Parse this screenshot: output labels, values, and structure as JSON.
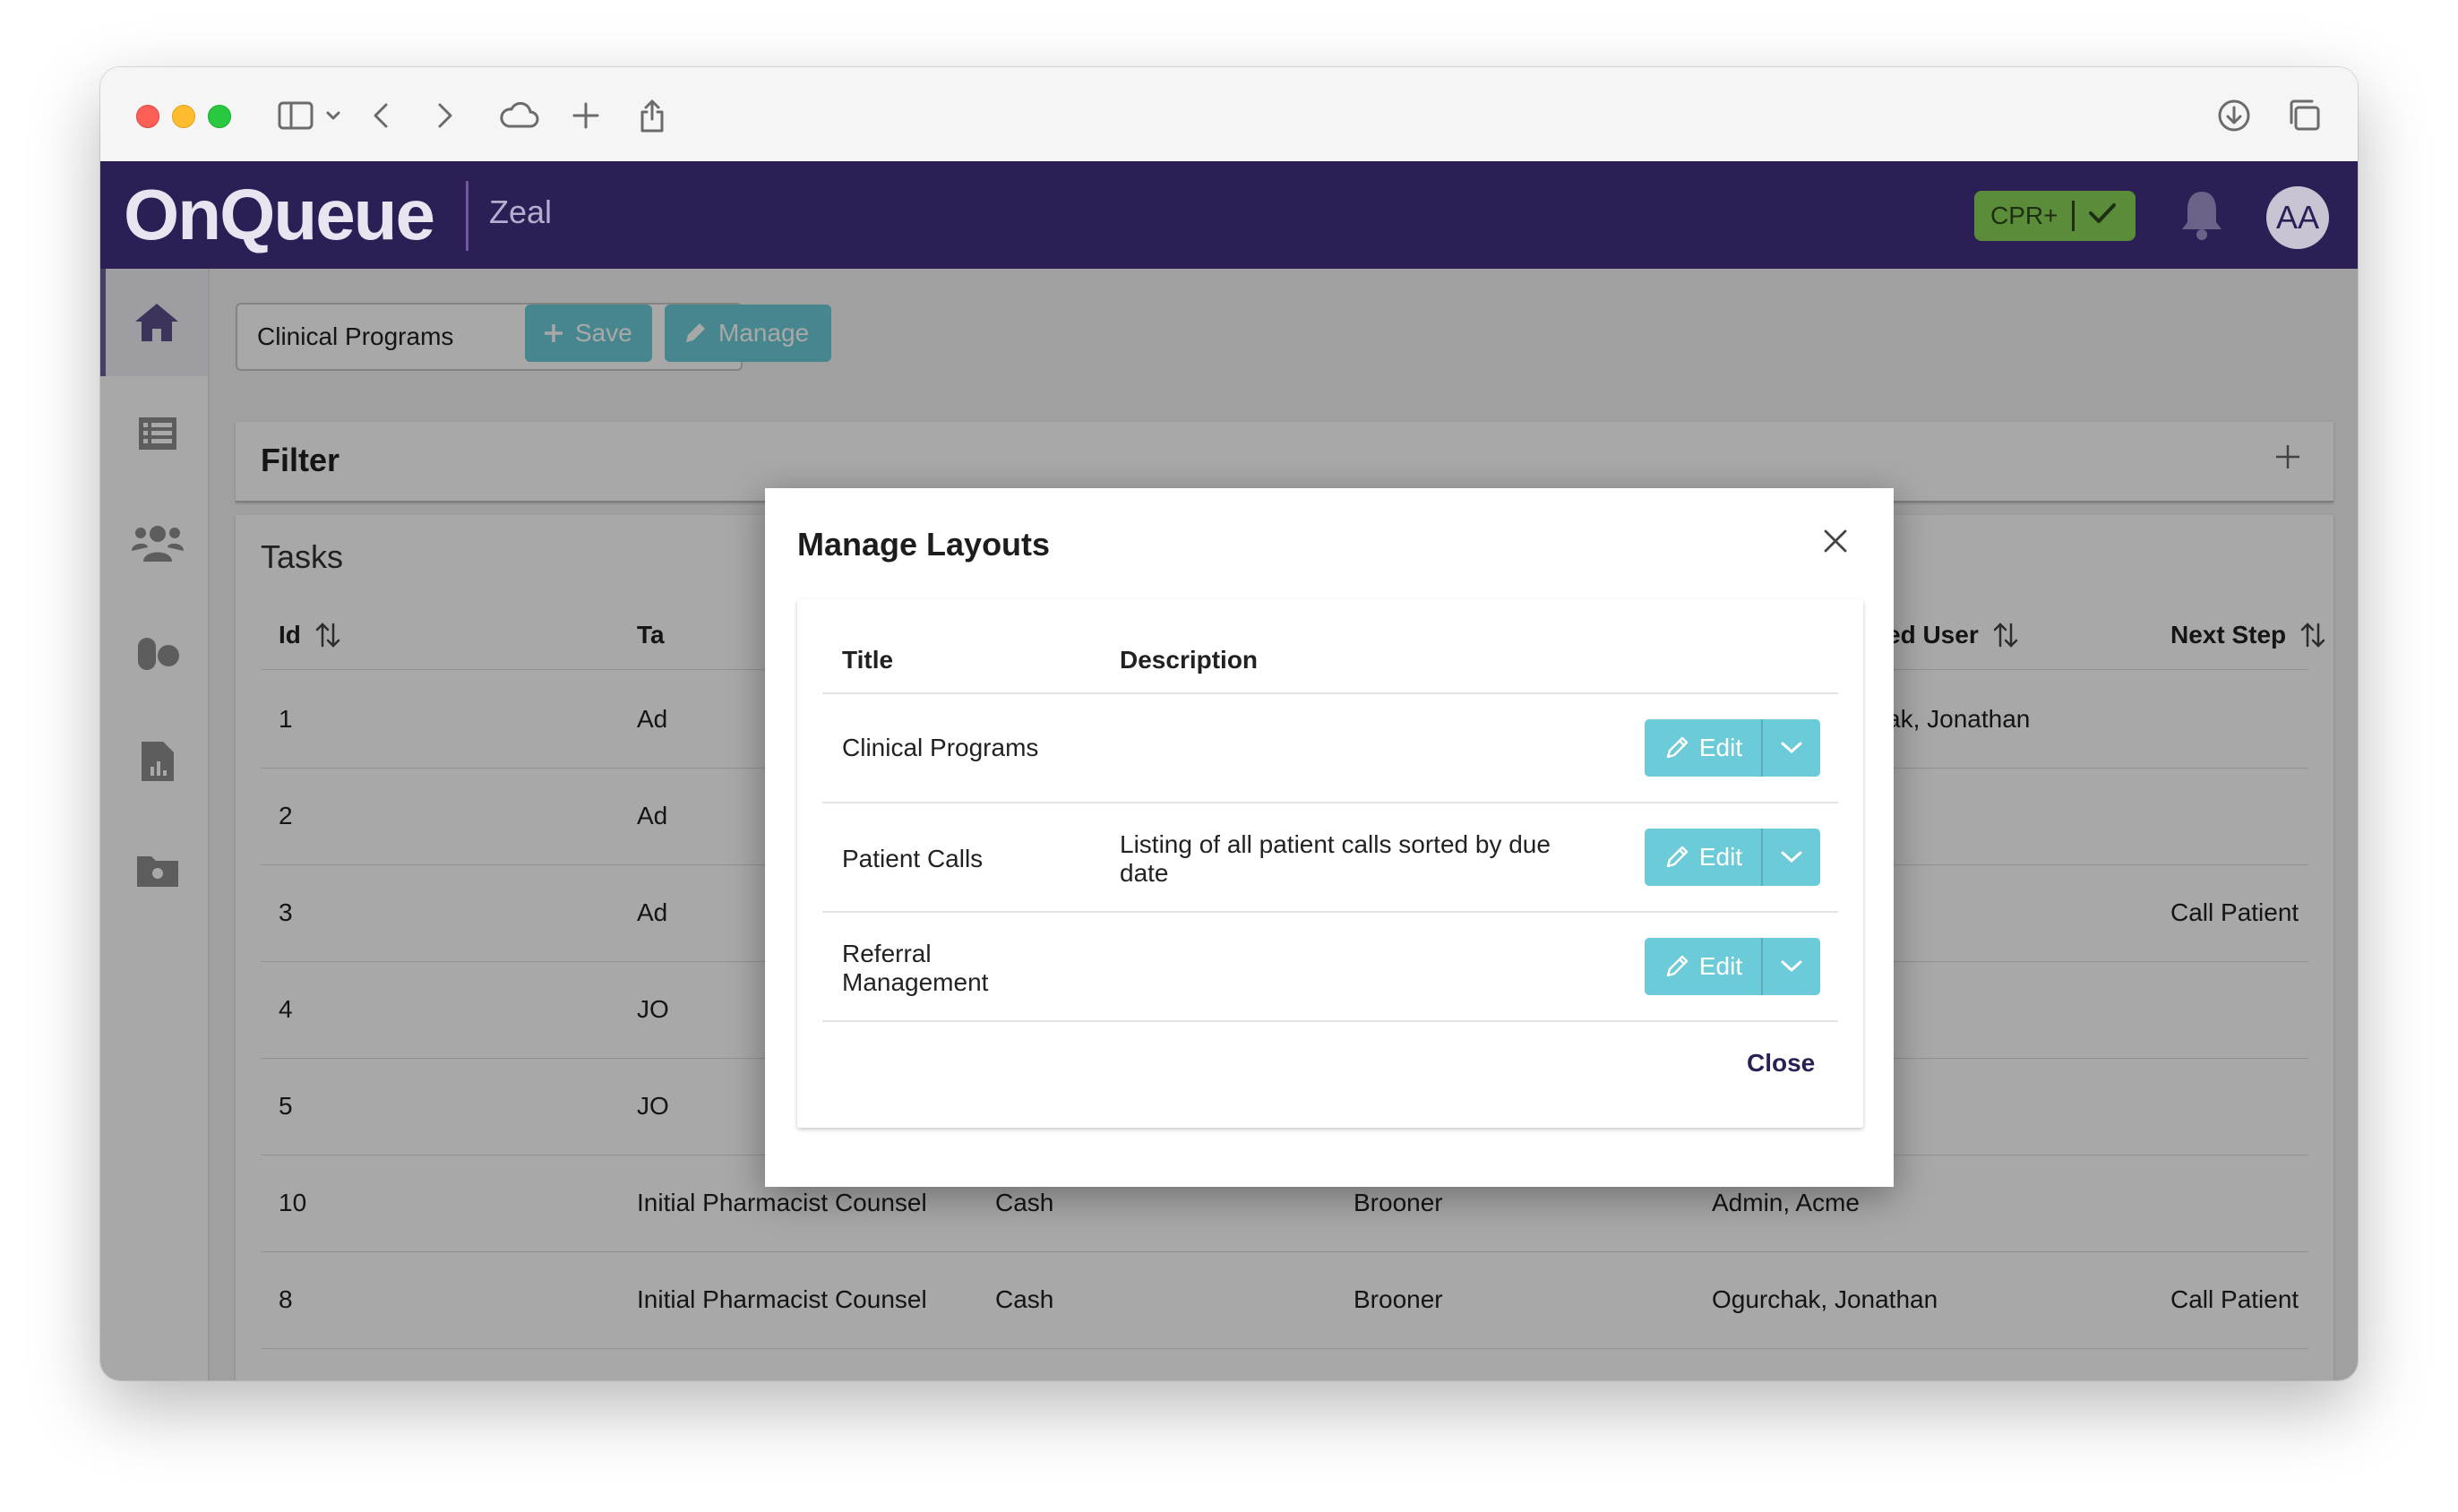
{
  "app": {
    "logo": "OnQueue",
    "subtitle": "Zeal",
    "cpr_badge": "CPR+",
    "avatar_initials": "AA",
    "brand_color": "#2b1f55",
    "accent_color": "#6ccbd8"
  },
  "toolbar": {
    "layout_select_value": "Clinical Programs",
    "save_label": "Save",
    "manage_label": "Manage"
  },
  "sidebar": {
    "items": [
      {
        "icon": "home-icon"
      },
      {
        "icon": "list-icon"
      },
      {
        "icon": "people-icon"
      },
      {
        "icon": "pills-icon"
      },
      {
        "icon": "report-icon"
      },
      {
        "icon": "folder-settings-icon"
      }
    ]
  },
  "filter": {
    "title": "Filter"
  },
  "tasks": {
    "title": "Tasks",
    "columns": [
      "Id",
      "Ta",
      "ed User",
      "Next Step"
    ],
    "rows": [
      {
        "id": "1",
        "task": "Ad",
        "payer": "",
        "pharmacy": "",
        "user": "ak, Jonathan",
        "next": ""
      },
      {
        "id": "2",
        "task": "Ad",
        "payer": "",
        "pharmacy": "",
        "user": "",
        "next": ""
      },
      {
        "id": "3",
        "task": "Ad",
        "payer": "",
        "pharmacy": "",
        "user": "",
        "next": "Call Patient"
      },
      {
        "id": "4",
        "task": "JO",
        "payer": "",
        "pharmacy": "",
        "user": "",
        "next": ""
      },
      {
        "id": "5",
        "task": "JO",
        "payer": "",
        "pharmacy": "",
        "user": "",
        "next": ""
      },
      {
        "id": "10",
        "task": "Initial Pharmacist Counsel",
        "payer": "Cash",
        "pharmacy": "Brooner",
        "user": "Admin, Acme",
        "next": ""
      },
      {
        "id": "8",
        "task": "Initial Pharmacist Counsel",
        "payer": "Cash",
        "pharmacy": "Brooner",
        "user": "Ogurchak, Jonathan",
        "next": "Call Patient"
      }
    ]
  },
  "modal": {
    "title": "Manage Layouts",
    "columns": {
      "title": "Title",
      "description": "Description"
    },
    "rows": [
      {
        "title": "Clinical Programs",
        "description": "",
        "edit_label": "Edit"
      },
      {
        "title": "Patient Calls",
        "description": "Listing of all patient calls sorted by due date",
        "edit_label": "Edit"
      },
      {
        "title": "Referral Management",
        "description": "",
        "edit_label": "Edit"
      }
    ],
    "close_label": "Close"
  }
}
